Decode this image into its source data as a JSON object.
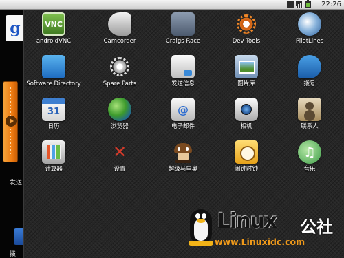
{
  "status_bar": {
    "time": "22:26"
  },
  "home": {
    "search_letter": "g",
    "label_top": "发送",
    "label_bottom": "拨"
  },
  "apps": [
    {
      "label": "androidVNC",
      "icon": "vnc-icon",
      "glyph": "VNC"
    },
    {
      "label": "Camcorder",
      "icon": "camcorder-icon",
      "glyph": ""
    },
    {
      "label": "Craigs Race",
      "icon": "craigs-race-icon",
      "glyph": ""
    },
    {
      "label": "Dev Tools",
      "icon": "dev-tools-gear-icon",
      "glyph": ""
    },
    {
      "label": "PilotLines",
      "icon": "pilotlines-icon",
      "glyph": ""
    },
    {
      "label": "Software Directory",
      "icon": "software-directory-icon",
      "glyph": ""
    },
    {
      "label": "Spare Parts",
      "icon": "spare-parts-gear-icon",
      "glyph": ""
    },
    {
      "label": "发送信息",
      "icon": "messaging-icon",
      "glyph": ""
    },
    {
      "label": "图片库",
      "icon": "gallery-icon",
      "glyph": ""
    },
    {
      "label": "拨号",
      "icon": "dialer-icon",
      "glyph": ""
    },
    {
      "label": "日历",
      "icon": "calendar-icon",
      "glyph": "31"
    },
    {
      "label": "浏览器",
      "icon": "browser-globe-icon",
      "glyph": ""
    },
    {
      "label": "电子邮件",
      "icon": "email-icon",
      "glyph": "@"
    },
    {
      "label": "相机",
      "icon": "camera-icon",
      "glyph": ""
    },
    {
      "label": "联系人",
      "icon": "contacts-icon",
      "glyph": ""
    },
    {
      "label": "计算器",
      "icon": "calculator-icon",
      "glyph": ""
    },
    {
      "label": "设置",
      "icon": "settings-icon",
      "glyph": "✕"
    },
    {
      "label": "超级马里奥",
      "icon": "super-mario-goomba-icon",
      "glyph": ""
    },
    {
      "label": "闹钟时钟",
      "icon": "alarm-clock-icon",
      "glyph": ""
    },
    {
      "label": "音乐",
      "icon": "music-icon",
      "glyph": "♫"
    }
  ],
  "watermark": {
    "brand": "Linux",
    "brand_cn": "公社",
    "url": "www.Linuxidc.com"
  }
}
